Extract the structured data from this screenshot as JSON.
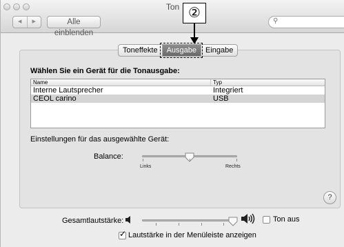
{
  "window": {
    "title": "Ton",
    "show_all_label": "Alle einblenden",
    "search_placeholder": ""
  },
  "callout": {
    "number": "②"
  },
  "tabs": [
    {
      "label": "Toneffekte",
      "selected": false
    },
    {
      "label": "Ausgabe",
      "selected": true
    },
    {
      "label": "Eingabe",
      "selected": false
    }
  ],
  "output": {
    "heading": "Wählen Sie ein Gerät für die Tonausgabe:",
    "columns": [
      "Name",
      "Typ"
    ],
    "rows": [
      {
        "name": "Interne Lautsprecher",
        "type": "Integriert",
        "selected": false
      },
      {
        "name": "CEOL carino",
        "type": "USB",
        "selected": true
      }
    ]
  },
  "settings": {
    "label": "Einstellungen für das ausgewählte Gerät:",
    "balance_label": "Balance:",
    "balance_left": "Links",
    "balance_right": "Rechts",
    "balance_value": 0.5
  },
  "help_label": "?",
  "volume": {
    "label": "Gesamtlautstärke:",
    "value": 0.97,
    "mute_label": "Ton aus",
    "mute_checked": false,
    "menubar_label": "Lautstärke in der Menüleiste anzeigen",
    "menubar_checked": true
  },
  "icons": {
    "back": "chevron-left-icon",
    "forward": "chevron-right-icon",
    "search": "search-icon",
    "volume_low": "speaker-low-icon",
    "volume_high": "speaker-high-icon"
  },
  "colors": {
    "selected_tab": "#7a7a7a",
    "selected_row": "#d4d4d4"
  }
}
